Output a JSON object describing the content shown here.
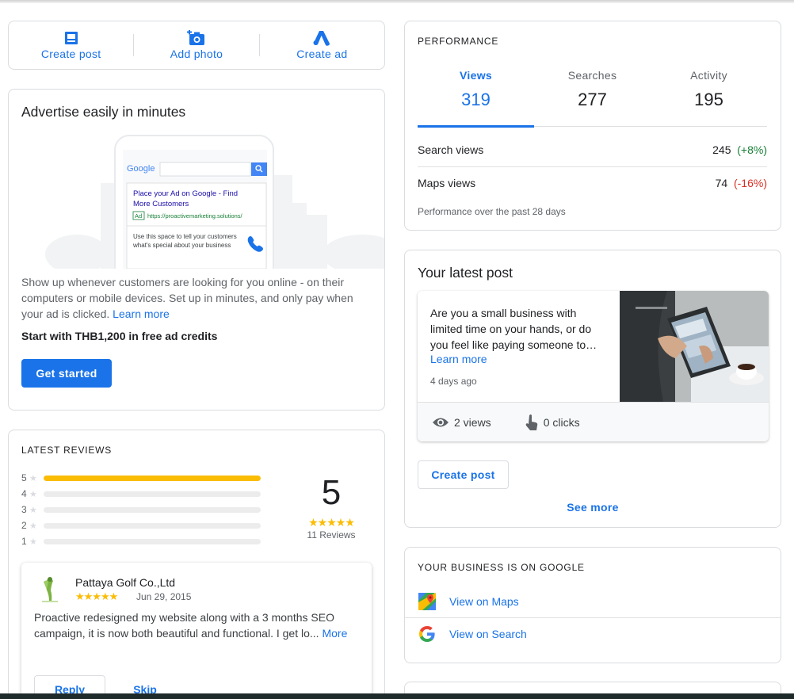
{
  "quick_actions": [
    {
      "label": "Create post",
      "icon": "post-icon"
    },
    {
      "label": "Add photo",
      "icon": "add-photo-icon"
    },
    {
      "label": "Create ad",
      "icon": "google-ads-icon"
    }
  ],
  "advertise": {
    "title": "Advertise easily in minutes",
    "mock": {
      "google": "Google",
      "ad_headline": "Place your Ad on Google - Find More Customers",
      "ad_badge": "Ad",
      "ad_url": "https://proactivemarketing.solutions/",
      "ad_body": "Use this space to tell your customers what's special about your business"
    },
    "description": "Show up whenever customers are looking for you online - on their computers or mobile devices. Set up in minutes, and only pay when your ad is clicked.",
    "learn_more": "Learn more",
    "credit": "Start with THB1,200 in free ad credits",
    "cta": "Get started"
  },
  "performance": {
    "heading": "PERFORMANCE",
    "tabs": [
      {
        "label": "Views",
        "value": "319"
      },
      {
        "label": "Searches",
        "value": "277"
      },
      {
        "label": "Activity",
        "value": "195"
      }
    ],
    "rows": [
      {
        "label": "Search views",
        "value": "245",
        "change": "(+8%)"
      },
      {
        "label": "Maps views",
        "value": "74",
        "change": "(-16%)"
      }
    ],
    "footer": "Performance over the past 28 days"
  },
  "latest_post": {
    "title": "Your latest post",
    "text": "Are you a small business with limited time on your hands, or do you feel like paying someone to…",
    "learn_more": "Learn more",
    "time": "4 days ago",
    "views": "2 views",
    "clicks": "0 clicks",
    "create_post": "Create post",
    "see_more": "See more"
  },
  "business_on_google": {
    "heading": "YOUR BUSINESS IS ON GOOGLE",
    "maps": "View on Maps",
    "search": "View on Search"
  },
  "reviews": {
    "heading": "LATEST REVIEWS",
    "bars": [
      {
        "star": "5",
        "fraction": 1.0
      },
      {
        "star": "4",
        "fraction": 0
      },
      {
        "star": "3",
        "fraction": 0
      },
      {
        "star": "2",
        "fraction": 0
      },
      {
        "star": "1",
        "fraction": 0
      }
    ],
    "rating": "5",
    "stars": "★★★★★",
    "count": "11 Reviews",
    "review": {
      "author": "Pattaya Golf Co.,Ltd",
      "stars": "★★★★★",
      "date": "Jun 29, 2015",
      "text": "Proactive redesigned my website along with a 3 months SEO campaign, it is now both beautiful and functional. I get lo...",
      "more": "More",
      "reply": "Reply",
      "skip": "Skip"
    }
  },
  "colors": {
    "accent": "#1a73e8",
    "star": "#fbbc04",
    "positive": "#188038",
    "negative": "#d93025"
  }
}
